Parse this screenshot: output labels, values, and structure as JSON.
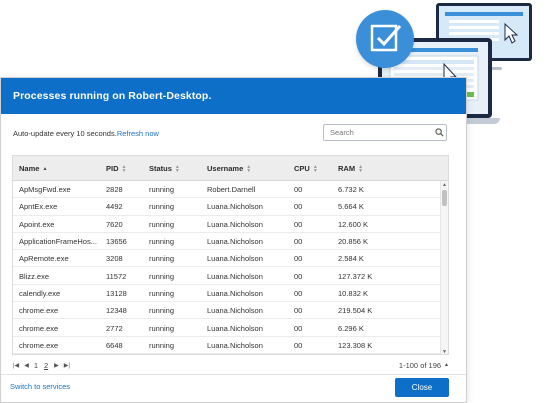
{
  "dialog": {
    "title": "Processes running on Robert-Desktop.",
    "auto_update_text": "Auto-update every 10 seconds.",
    "refresh_label": "Refresh now",
    "search_placeholder": "Search",
    "columns": [
      "Name",
      "PID",
      "Status",
      "Username",
      "CPU",
      "RAM"
    ],
    "sort_column": "Name",
    "rows": [
      {
        "name": "ApMsgFwd.exe",
        "pid": "2828",
        "status": "running",
        "username": "Robert.Darnell",
        "cpu": "00",
        "ram": "6.732 K"
      },
      {
        "name": "ApntEx.exe",
        "pid": "4492",
        "status": "running",
        "username": "Luana.Nicholson",
        "cpu": "00",
        "ram": "5.664 K"
      },
      {
        "name": "Apoint.exe",
        "pid": "7620",
        "status": "running",
        "username": "Luana.Nicholson",
        "cpu": "00",
        "ram": "12.600 K"
      },
      {
        "name": "ApplicationFrameHos...",
        "pid": "13656",
        "status": "running",
        "username": "Luana.Nicholson",
        "cpu": "00",
        "ram": "20.856 K"
      },
      {
        "name": "ApRemote.exe",
        "pid": "3208",
        "status": "running",
        "username": "Luana.Nicholson",
        "cpu": "00",
        "ram": "2.584 K"
      },
      {
        "name": "Blizz.exe",
        "pid": "11572",
        "status": "running",
        "username": "Luana.Nicholson",
        "cpu": "00",
        "ram": "127.372 K"
      },
      {
        "name": "calendly.exe",
        "pid": "13128",
        "status": "running",
        "username": "Luana.Nicholson",
        "cpu": "00",
        "ram": "10.832 K"
      },
      {
        "name": "chrome.exe",
        "pid": "12348",
        "status": "running",
        "username": "Luana.Nicholson",
        "cpu": "00",
        "ram": "219.504 K"
      },
      {
        "name": "chrome.exe",
        "pid": "2772",
        "status": "running",
        "username": "Luana.Nicholson",
        "cpu": "00",
        "ram": "6.296 K"
      },
      {
        "name": "chrome.exe",
        "pid": "6648",
        "status": "running",
        "username": "Luana.Nicholson",
        "cpu": "00",
        "ram": "123.308 K"
      }
    ],
    "pager": {
      "first_icon": "first-page-icon",
      "prev_icon": "prev-page-icon",
      "pages": [
        "1",
        "2"
      ],
      "current_page": "2",
      "next_icon": "next-page-icon",
      "last_icon": "last-page-icon",
      "range_text": "1-100 of 196"
    },
    "switch_label": "Switch to services",
    "close_label": "Close"
  },
  "colors": {
    "accent": "#0d6fc8",
    "link": "#1a73c7",
    "header_bg": "#ededed"
  },
  "icons": {
    "search": "search-icon",
    "illustration": "remote-desktop-illustration"
  }
}
